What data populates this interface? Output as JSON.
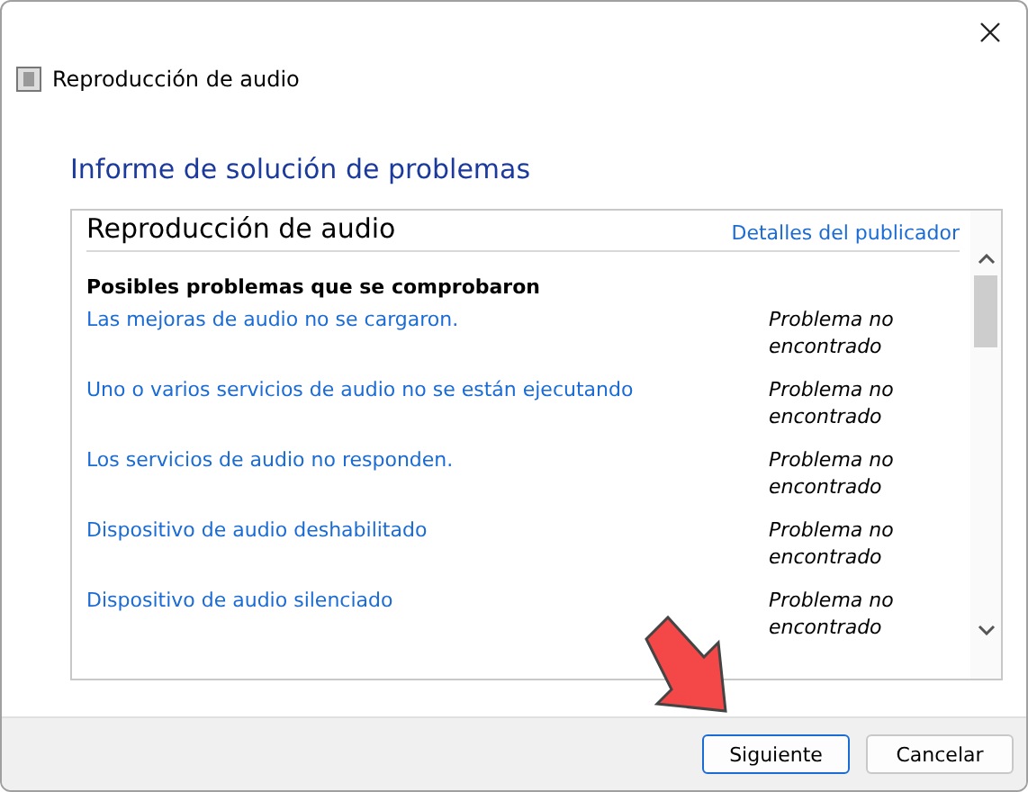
{
  "window": {
    "title": "Reproducción de audio"
  },
  "heading": "Informe de solución de problemas",
  "report": {
    "title": "Reproducción de audio",
    "publisher_link": "Detalles del publicador",
    "section_title": "Posibles problemas que se comprobaron",
    "problems": [
      {
        "name": "Las mejoras de audio no se cargaron.",
        "status": "Problema no encontrado"
      },
      {
        "name": "Uno o varios servicios de audio no se están ejecutando",
        "status": "Problema no encontrado"
      },
      {
        "name": "Los servicios de audio no responden.",
        "status": "Problema no encontrado"
      },
      {
        "name": "Dispositivo de audio deshabilitado",
        "status": "Problema no encontrado"
      },
      {
        "name": "Dispositivo de audio silenciado",
        "status": "Problema no encontrado"
      }
    ]
  },
  "buttons": [
    {
      "label": "Siguiente",
      "selected": true
    },
    {
      "label": "Cancelar",
      "selected": false
    }
  ]
}
